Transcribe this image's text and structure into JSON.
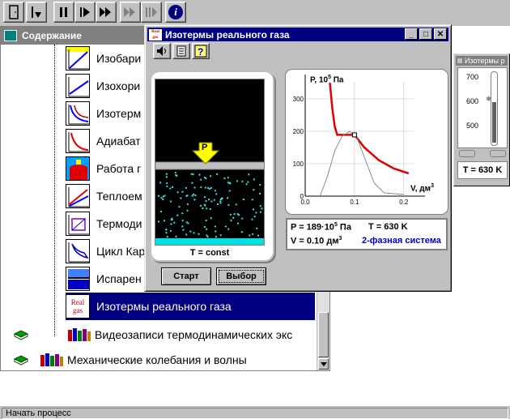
{
  "toolbar": {
    "buttons": [
      "exit-door",
      "step-in",
      "pause",
      "stop",
      "fast-forward",
      "skip",
      "bars",
      "info"
    ],
    "info_glyph": "i"
  },
  "contents": {
    "title": "Содержание",
    "items": [
      {
        "label": "Изобари",
        "icon": "isobar-chart-icon"
      },
      {
        "label": "Изохори",
        "icon": "isochore-chart-icon"
      },
      {
        "label": "Изотерм",
        "icon": "isotherm-chart-icon"
      },
      {
        "label": "Адиабат",
        "icon": "adiabat-chart-icon"
      },
      {
        "label": "Работа г",
        "icon": "gas-work-icon"
      },
      {
        "label": "Теплоем",
        "icon": "heat-capacity-chart-icon"
      },
      {
        "label": "Термоди",
        "icon": "thermodynamics-chart-icon"
      },
      {
        "label": "Цикл Кар",
        "icon": "carnot-cycle-icon"
      },
      {
        "label": "Испарен",
        "icon": "evaporation-icon"
      },
      {
        "label": "Изотермы реального газа",
        "icon": "real-gas-icon",
        "selected": true
      },
      {
        "label": "Видеозаписи термодинамических экс",
        "icon": "video-books-icon"
      },
      {
        "label": "Механические колебания и волны",
        "icon": "books-icon"
      }
    ],
    "real_gas_icon_text": [
      "Real",
      "gas"
    ]
  },
  "main_window": {
    "title": "Изотермы реального газа",
    "app_icon_text": "Real gas",
    "ctl_minimize": "_",
    "ctl_maximize": "□",
    "ctl_close": "✕",
    "sim_caption": "T = const",
    "piston_label": "P",
    "start_button": "Старт",
    "select_button": "Выбор",
    "plot": {
      "ylabel_prefix": "P, 10",
      "ylabel_exp": "5",
      "ylabel_suffix": " Па",
      "xlabel_prefix": "V, дм",
      "xlabel_exp": "3",
      "y_ticks": [
        "0",
        "100",
        "200",
        "300"
      ],
      "x_ticks": [
        "0.0",
        "0.1",
        "0.2"
      ]
    },
    "readout": {
      "p_text": "P = 189·10",
      "p_exp": "5",
      "p_unit": "Па",
      "t_text": "T = 630 K",
      "v_text": "V = 0.10 дм",
      "v_exp": "3",
      "phase": "2-фазная система",
      "phase_color": "#0000c0"
    }
  },
  "chart_data": {
    "type": "line",
    "xlabel": "V, дм³",
    "ylabel": "P, 10⁵ Па",
    "xlim": [
      0,
      0.22
    ],
    "ylim": [
      0,
      350
    ],
    "series": [
      {
        "values": [
          [
            0.05,
            350
          ],
          [
            0.055,
            270
          ],
          [
            0.06,
            215
          ],
          [
            0.065,
            189
          ],
          [
            0.1,
            189
          ],
          [
            0.12,
            150
          ],
          [
            0.15,
            110
          ],
          [
            0.18,
            85
          ],
          [
            0.21,
            70
          ]
        ],
        "color": "#e00000"
      },
      {
        "values": [
          [
            0.03,
            0
          ],
          [
            0.045,
            60
          ],
          [
            0.06,
            140
          ],
          [
            0.075,
            185
          ],
          [
            0.09,
            200
          ],
          [
            0.105,
            180
          ],
          [
            0.12,
            120
          ],
          [
            0.14,
            40
          ],
          [
            0.16,
            10
          ],
          [
            0.2,
            5
          ]
        ],
        "color": "#808080"
      }
    ],
    "marker": {
      "x": 0.1,
      "y": 189
    }
  },
  "thermometer": {
    "title": "Изотермы р",
    "scale": [
      "700",
      "600",
      "500"
    ],
    "value_text": "T = 630 K",
    "temperature": 630
  },
  "status": {
    "text": "Начать процесс"
  }
}
